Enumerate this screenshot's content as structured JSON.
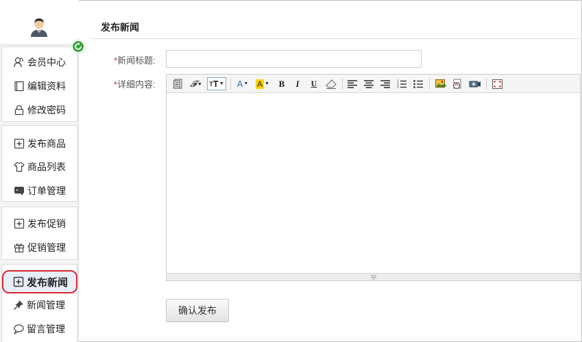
{
  "sidebar": {
    "groups": [
      {
        "items": [
          {
            "label": "会员中心",
            "icon": "user-icon"
          },
          {
            "label": "编辑资料",
            "icon": "edit-profile-icon"
          },
          {
            "label": "修改密码",
            "icon": "lock-icon"
          }
        ]
      },
      {
        "items": [
          {
            "label": "发布商品",
            "icon": "plus-box-icon"
          },
          {
            "label": "商品列表",
            "icon": "tshirt-icon"
          },
          {
            "label": "订单管理",
            "icon": "order-icon"
          }
        ]
      },
      {
        "items": [
          {
            "label": "发布促销",
            "icon": "plus-box-icon"
          },
          {
            "label": "促销管理",
            "icon": "gift-icon"
          }
        ]
      },
      {
        "items": [
          {
            "label": "发布新闻",
            "icon": "plus-box-icon",
            "active": true
          },
          {
            "label": "新闻管理",
            "icon": "pin-icon"
          },
          {
            "label": "留言管理",
            "icon": "speech-bubble-icon"
          }
        ]
      }
    ]
  },
  "main": {
    "page_title": "发布新闻",
    "form": {
      "title_label": "新闻标题:",
      "title_value": "",
      "content_label": "详细内容:",
      "required_mark": "*",
      "submit_label": "确认发布"
    },
    "toolbar": [
      "source",
      "font-family",
      "font-size",
      "font-color",
      "highlight-color",
      "bold",
      "italic",
      "underline",
      "clear-format",
      "align-left",
      "align-center",
      "align-right",
      "ordered-list",
      "unordered-list",
      "insert-image",
      "insert-flash",
      "insert-media",
      "fullscreen"
    ]
  },
  "colors": {
    "required": "#d9262c",
    "active_ring": "#d9262c",
    "refresh_badge": "#39a539"
  }
}
